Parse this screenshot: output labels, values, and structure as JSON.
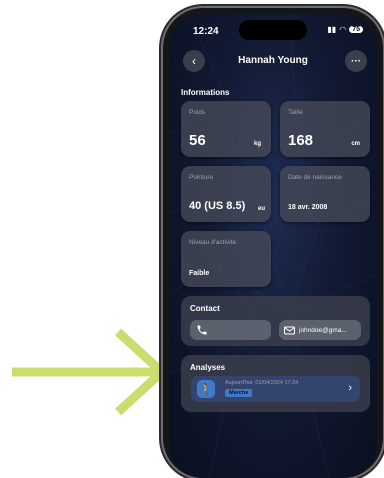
{
  "status": {
    "time": "12:24",
    "battery": "75"
  },
  "header": {
    "title": "Hannah Young",
    "more": "···"
  },
  "informations": {
    "label": "Informations",
    "poids": {
      "label": "Poids",
      "value": "56",
      "unit": "kg"
    },
    "taille": {
      "label": "Taille",
      "value": "168",
      "unit": "cm"
    },
    "pointure": {
      "label": "Pointure",
      "value": "40 (US 8.5)",
      "unit": "eu"
    },
    "naissance": {
      "label": "Date de naissance",
      "value": "18 avr. 2008"
    },
    "activite": {
      "label": "Niveau d'activité",
      "value": "Faible"
    }
  },
  "contact": {
    "label": "Contact",
    "email": "johndoe@gma..."
  },
  "analyses": {
    "label": "Analyses",
    "date": "Aujourd'hui, 01/04/2024 17:24",
    "tag": "Marche"
  },
  "colors": {
    "accent": "#3f79c8",
    "arrow": "#cddc6e",
    "card": "#464a58"
  }
}
